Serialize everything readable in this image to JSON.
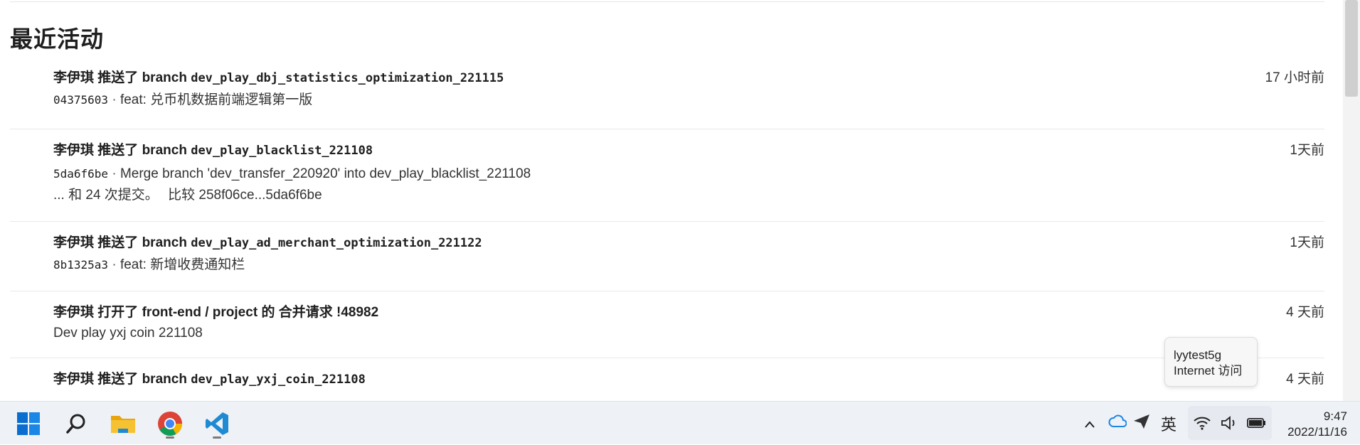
{
  "section_title": "最近活动",
  "activities": [
    {
      "user": "李伊琪",
      "action": "推送了 branch",
      "branch": "dev_play_dbj_statistics_optimization_221115",
      "time": "17 小时前",
      "commit_sha": "04375603",
      "commit_sep": " · ",
      "commit_message": "feat: 兑币机数据前端逻辑第一版"
    },
    {
      "user": "李伊琪",
      "action": "推送了 branch",
      "branch": "dev_play_blacklist_221108",
      "time": "1天前",
      "commit_sha": "5da6f6be",
      "commit_sep": " · ",
      "commit_message": "Merge branch 'dev_transfer_220920' into dev_play_blacklist_221108",
      "more_prefix": "... 和 24 次提交。",
      "compare_label": "比较",
      "compare_range": "258f06ce...5da6f6be"
    },
    {
      "user": "李伊琪",
      "action": "推送了 branch",
      "branch": "dev_play_ad_merchant_optimization_221122",
      "time": "1天前",
      "commit_sha": "8b1325a3",
      "commit_sep": " · ",
      "commit_message": "feat: 新增收费通知栏"
    },
    {
      "user": "李伊琪",
      "action": "打开了",
      "project": "front-end / project",
      "of": "的",
      "mr_label": "合并请求",
      "mr_id": "!48982",
      "time": "4 天前",
      "description": "Dev play yxj coin 221108"
    },
    {
      "user": "李伊琪",
      "action": "推送了 branch",
      "branch": "dev_play_yxj_coin_221108",
      "time": "4 天前"
    }
  ],
  "tooltip": {
    "network": "lyytest5g",
    "status": "Internet 访问"
  },
  "taskbar": {
    "apps": [
      "windows-start",
      "search",
      "file-explorer",
      "chrome",
      "vscode"
    ],
    "tray": {
      "overflow_glyph": "^",
      "ime": "英"
    },
    "time": "9:47",
    "date": "2022/11/16"
  },
  "colors": {
    "taskbar_bg": "#eef1f6",
    "windows_blue": "#0a6ed1",
    "vscode_blue": "#1f8ad2",
    "folder_yellow": "#f2b31a"
  }
}
